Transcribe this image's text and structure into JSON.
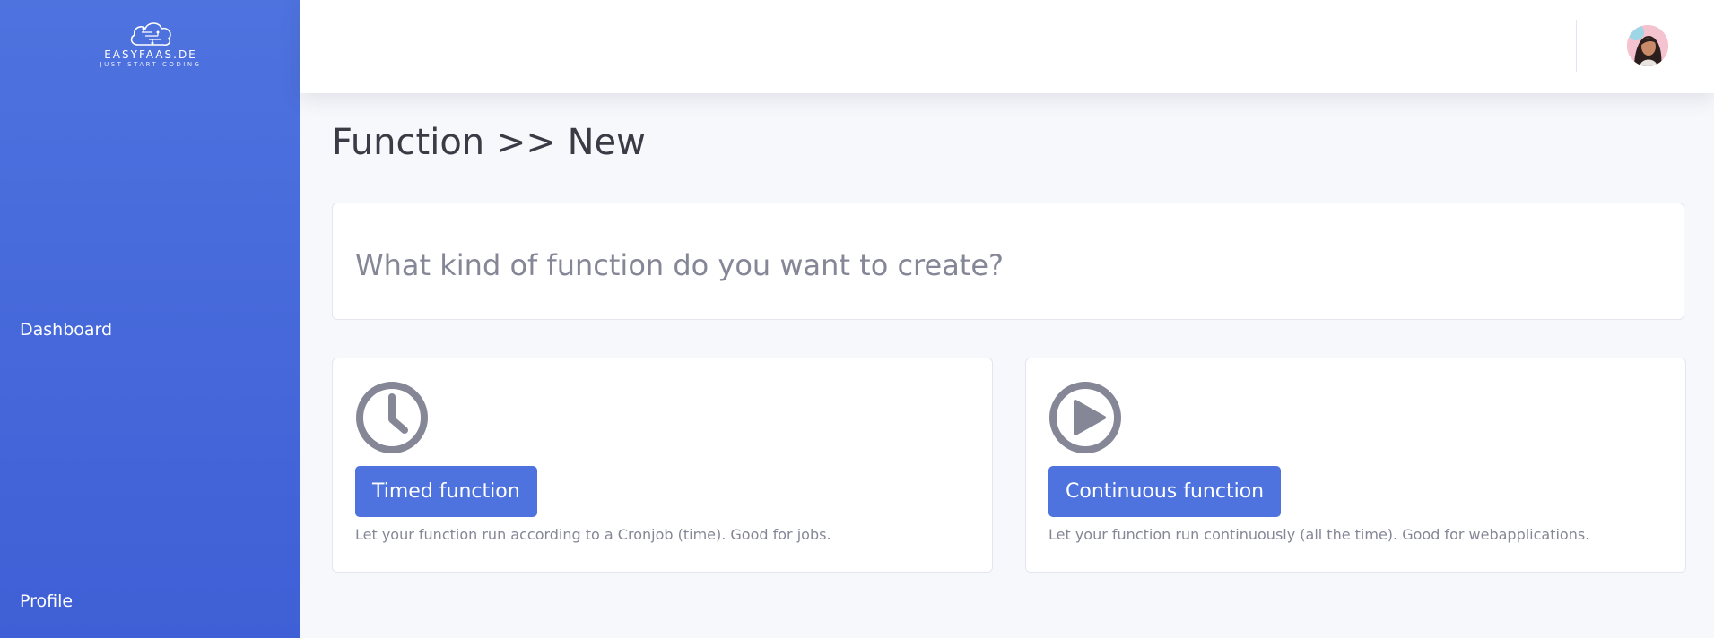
{
  "brand": {
    "name": "EASYFAAS.DE",
    "tagline": "JUST START CODING"
  },
  "sidebar": {
    "items": [
      {
        "label": "Dashboard"
      },
      {
        "label": "Profile"
      }
    ]
  },
  "topbar": {
    "avatar_icon": "user-avatar"
  },
  "page": {
    "title": "Function >> New",
    "question": "What kind of function do you want to create?"
  },
  "options": [
    {
      "icon": "clock-icon",
      "button_label": "Timed function",
      "description": "Let your function run according to a Cronjob (time). Good for jobs."
    },
    {
      "icon": "play-circle-icon",
      "button_label": "Continuous function",
      "description": "Let your function run continuously (all the time). Good for webapplications."
    }
  ],
  "colors": {
    "primary": "#4e73df",
    "sidebar_gradient_end": "#3f5fd6",
    "icon_gray": "#858796",
    "background": "#f7f8fc"
  }
}
